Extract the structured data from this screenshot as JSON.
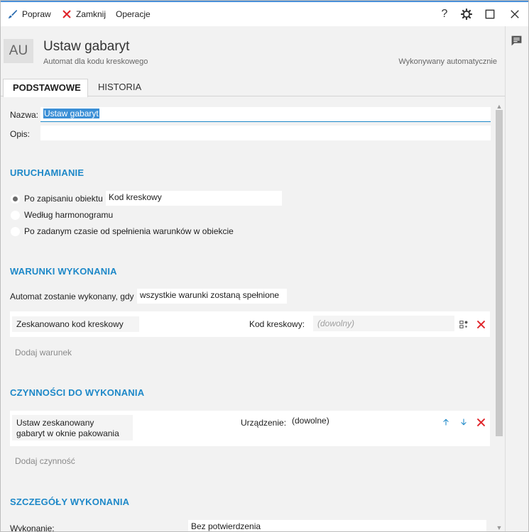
{
  "toolbar": {
    "fix_label": "Popraw",
    "close_label": "Zamknij",
    "operations_label": "Operacje"
  },
  "header": {
    "avatar": "AU",
    "title": "Ustaw gabaryt",
    "subtitle": "Automat dla kodu kreskowego",
    "exec_mode": "Wykonywany automatycznie"
  },
  "tabs": [
    {
      "label": "PODSTAWOWE",
      "active": true
    },
    {
      "label": "HISTORIA",
      "active": false
    }
  ],
  "form": {
    "name_label": "Nazwa:",
    "name_value": "Ustaw gabaryt",
    "desc_label": "Opis:",
    "desc_value": ""
  },
  "startup": {
    "title": "URUCHAMIANIE",
    "options": [
      {
        "label": "Po zapisaniu obiektu",
        "selected": true,
        "value": "Kod kreskowy"
      },
      {
        "label": "Według harmonogramu",
        "selected": false
      },
      {
        "label": "Po zadanym czasie od spełnienia warunków w obiekcie",
        "selected": false
      }
    ]
  },
  "conditions": {
    "title": "WARUNKI WYKONANIA",
    "rule_label": "Automat zostanie wykonany, gdy",
    "rule_value": "wszystkie warunki zostaną spełnione",
    "items": [
      {
        "name": "Zeskanowano kod kreskowy",
        "param_label": "Kod kreskowy:",
        "param_placeholder": "(dowolny)"
      }
    ],
    "add_label": "Dodaj warunek"
  },
  "actions": {
    "title": "CZYNNOŚCI DO WYKONANIA",
    "items": [
      {
        "name_line1": "Ustaw zeskanowany",
        "name_line2": "gabaryt w oknie pakowania",
        "param_label": "Urządzenie:",
        "param_value": "(dowolne)"
      }
    ],
    "add_label": "Dodaj czynność"
  },
  "details": {
    "title": "SZCZEGÓŁY WYKONANIA",
    "exec_label": "Wykonanie:",
    "exec_value": "Bez potwierdzenia"
  },
  "colors": {
    "accent": "#1d88c8",
    "danger": "#e0242a",
    "selection": "#3b8fd6"
  }
}
